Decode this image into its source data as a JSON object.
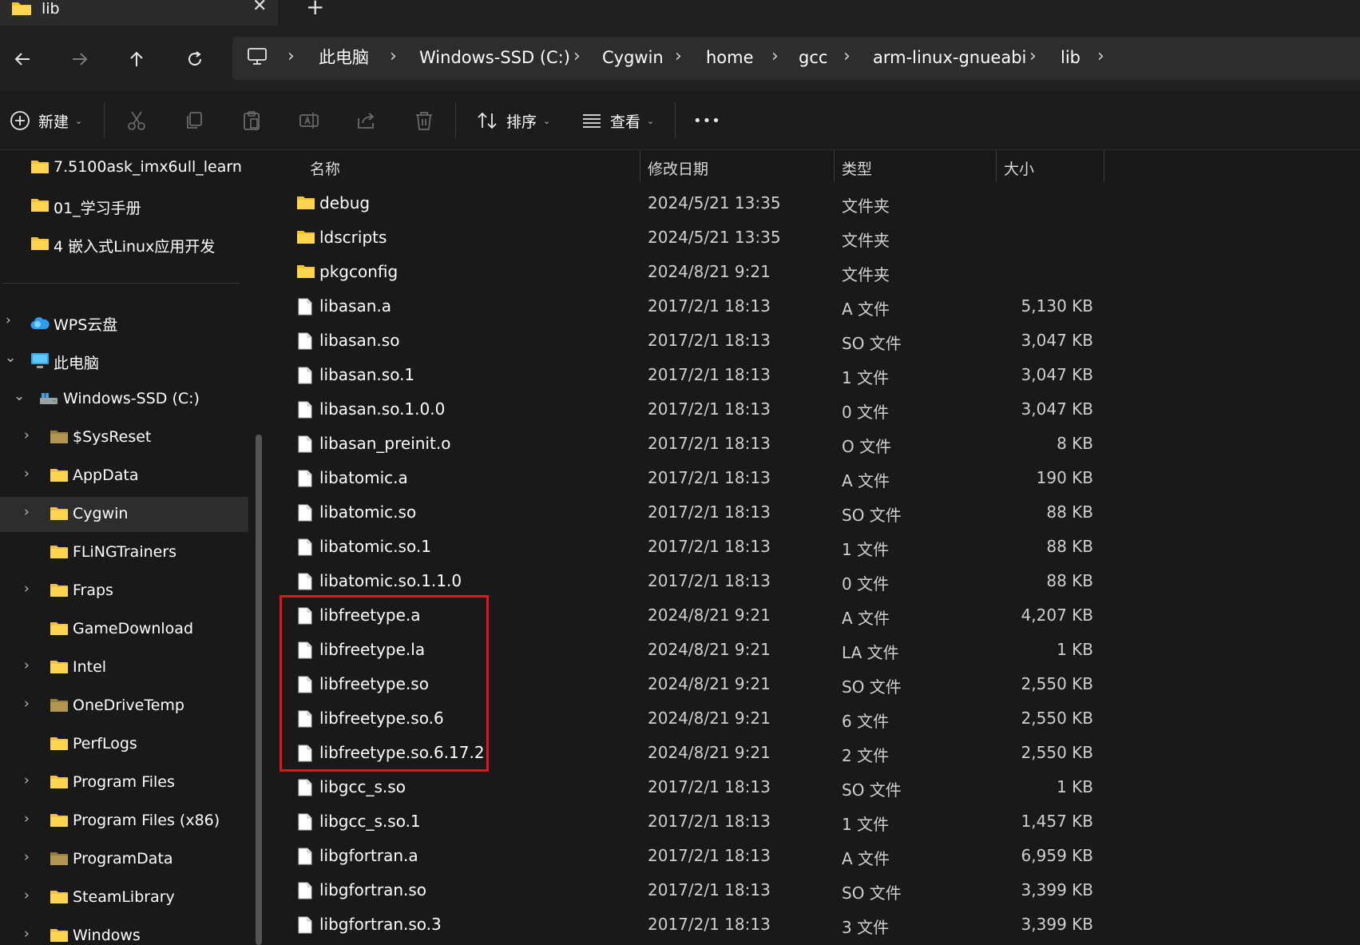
{
  "tab": {
    "title": "lib",
    "close_glyph": "✕",
    "new_tab_glyph": "+"
  },
  "nav": {
    "back_glyph": "←",
    "forward_glyph": "→",
    "up_glyph": "↑",
    "refresh_glyph": "↻",
    "breadcrumbs": [
      "此电脑",
      "Windows-SSD (C:)",
      "Cygwin",
      "home",
      "gcc",
      "arm-linux-gnueabi",
      "lib"
    ],
    "separator": "›"
  },
  "toolbar": {
    "new_label": "新建",
    "sort_label": "排序",
    "view_label": "查看",
    "more_glyph": "•••",
    "caret": "⌄"
  },
  "sidebar": {
    "quick_items": [
      {
        "label": "7.5100ask_imx6ull_learn"
      },
      {
        "label": "01_学习手册"
      },
      {
        "label": "4 嵌入式Linux应用开发"
      }
    ],
    "wps": {
      "label": "WPS云盘",
      "chevron": "›"
    },
    "this_pc": {
      "label": "此电脑",
      "chevron": "⌄"
    },
    "drive": {
      "label": "Windows-SSD (C:)",
      "chevron": "⌄"
    },
    "folders": [
      {
        "label": "$SysReset",
        "chevron": "›",
        "dim": true
      },
      {
        "label": "AppData",
        "chevron": "›",
        "dim": false
      },
      {
        "label": "Cygwin",
        "chevron": "›",
        "dim": false,
        "selected": true
      },
      {
        "label": "FLiNGTrainers",
        "chevron": "",
        "dim": false
      },
      {
        "label": "Fraps",
        "chevron": "›",
        "dim": false
      },
      {
        "label": "GameDownload",
        "chevron": "",
        "dim": false
      },
      {
        "label": "Intel",
        "chevron": "›",
        "dim": false
      },
      {
        "label": "OneDriveTemp",
        "chevron": "›",
        "dim": true
      },
      {
        "label": "PerfLogs",
        "chevron": "",
        "dim": false
      },
      {
        "label": "Program Files",
        "chevron": "›",
        "dim": false
      },
      {
        "label": "Program Files (x86)",
        "chevron": "›",
        "dim": false
      },
      {
        "label": "ProgramData",
        "chevron": "›",
        "dim": true
      },
      {
        "label": "SteamLibrary",
        "chevron": "›",
        "dim": false
      },
      {
        "label": "Windows",
        "chevron": "›",
        "dim": false
      }
    ]
  },
  "filelist": {
    "columns": {
      "name": "名称",
      "date": "修改日期",
      "type": "类型",
      "size": "大小",
      "sort_glyph": "^"
    },
    "rows": [
      {
        "name": "debug",
        "date": "2024/5/21 13:35",
        "type": "文件夹",
        "size": "",
        "kind": "folder"
      },
      {
        "name": "ldscripts",
        "date": "2024/5/21 13:35",
        "type": "文件夹",
        "size": "",
        "kind": "folder"
      },
      {
        "name": "pkgconfig",
        "date": "2024/8/21 9:21",
        "type": "文件夹",
        "size": "",
        "kind": "folder"
      },
      {
        "name": "libasan.a",
        "date": "2017/2/1 18:13",
        "type": "A 文件",
        "size": "5,130 KB",
        "kind": "file"
      },
      {
        "name": "libasan.so",
        "date": "2017/2/1 18:13",
        "type": "SO 文件",
        "size": "3,047 KB",
        "kind": "file"
      },
      {
        "name": "libasan.so.1",
        "date": "2017/2/1 18:13",
        "type": "1 文件",
        "size": "3,047 KB",
        "kind": "file"
      },
      {
        "name": "libasan.so.1.0.0",
        "date": "2017/2/1 18:13",
        "type": "0 文件",
        "size": "3,047 KB",
        "kind": "file"
      },
      {
        "name": "libasan_preinit.o",
        "date": "2017/2/1 18:13",
        "type": "O 文件",
        "size": "8 KB",
        "kind": "file"
      },
      {
        "name": "libatomic.a",
        "date": "2017/2/1 18:13",
        "type": "A 文件",
        "size": "190 KB",
        "kind": "file"
      },
      {
        "name": "libatomic.so",
        "date": "2017/2/1 18:13",
        "type": "SO 文件",
        "size": "88 KB",
        "kind": "file"
      },
      {
        "name": "libatomic.so.1",
        "date": "2017/2/1 18:13",
        "type": "1 文件",
        "size": "88 KB",
        "kind": "file"
      },
      {
        "name": "libatomic.so.1.1.0",
        "date": "2017/2/1 18:13",
        "type": "0 文件",
        "size": "88 KB",
        "kind": "file"
      },
      {
        "name": "libfreetype.a",
        "date": "2024/8/21 9:21",
        "type": "A 文件",
        "size": "4,207 KB",
        "kind": "file"
      },
      {
        "name": "libfreetype.la",
        "date": "2024/8/21 9:21",
        "type": "LA 文件",
        "size": "1 KB",
        "kind": "file"
      },
      {
        "name": "libfreetype.so",
        "date": "2024/8/21 9:21",
        "type": "SO 文件",
        "size": "2,550 KB",
        "kind": "file"
      },
      {
        "name": "libfreetype.so.6",
        "date": "2024/8/21 9:21",
        "type": "6 文件",
        "size": "2,550 KB",
        "kind": "file"
      },
      {
        "name": "libfreetype.so.6.17.2",
        "date": "2024/8/21 9:21",
        "type": "2 文件",
        "size": "2,550 KB",
        "kind": "file"
      },
      {
        "name": "libgcc_s.so",
        "date": "2017/2/1 18:13",
        "type": "SO 文件",
        "size": "1 KB",
        "kind": "file"
      },
      {
        "name": "libgcc_s.so.1",
        "date": "2017/2/1 18:13",
        "type": "1 文件",
        "size": "1,457 KB",
        "kind": "file"
      },
      {
        "name": "libgfortran.a",
        "date": "2017/2/1 18:13",
        "type": "A 文件",
        "size": "6,959 KB",
        "kind": "file"
      },
      {
        "name": "libgfortran.so",
        "date": "2017/2/1 18:13",
        "type": "SO 文件",
        "size": "3,399 KB",
        "kind": "file"
      },
      {
        "name": "libgfortran.so.3",
        "date": "2017/2/1 18:13",
        "type": "3 文件",
        "size": "3,399 KB",
        "kind": "file"
      }
    ]
  },
  "colors": {
    "folder": "#f4c430",
    "folder_dim": "#9a7f3a",
    "highlight": "#e8121a",
    "selected_bg": "#2d2d2d"
  }
}
